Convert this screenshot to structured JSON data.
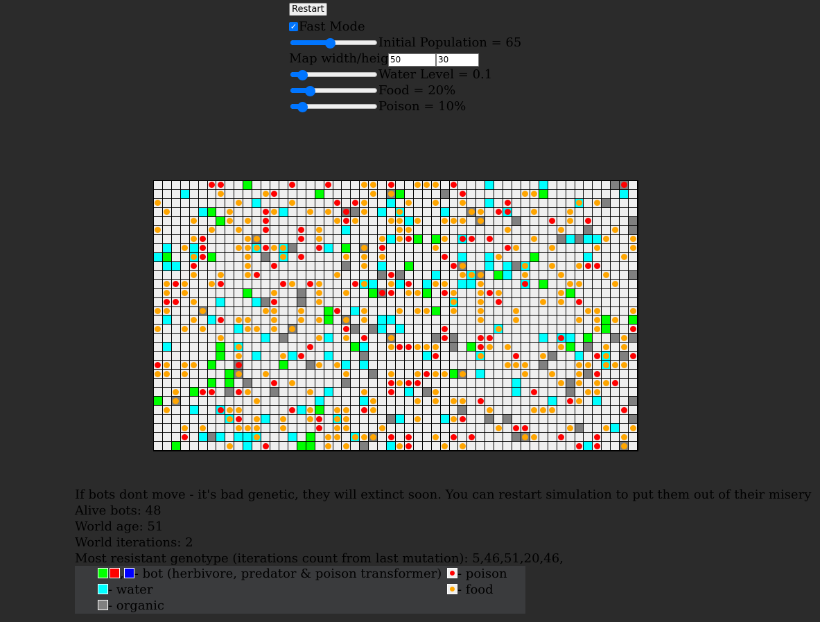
{
  "controls": {
    "restart_label": "Restart",
    "fast_mode_label": "Fast Mode",
    "fast_mode_checked": true,
    "initial_population_label": "Initial Population = 65",
    "initial_population_level": 0.45,
    "map_size_label": "Map width/height",
    "map_width": "50",
    "map_height": "30",
    "water_level_label": "Water Level = 0.1",
    "water_level_level": 0.1,
    "food_label": "Food = 20%",
    "food_level": 0.2,
    "poison_label": "Poison = 10%",
    "poison_level": 0.1
  },
  "colors": {
    "background": "#2b2b2b",
    "cell_empty": "#efefef",
    "water": "#00ffff",
    "organic": "#808080",
    "herbivore": "#00ff00",
    "predator": "#ff0000",
    "poison_transformer": "#0000ff",
    "food": "#ffa500",
    "poison": "#ff0000",
    "accent": "#0075ff"
  },
  "info": {
    "hint": "If bots dont move - it's bad genetic, they will extinct soon. You can restart simulation to put them out of their misery",
    "alive_bots": "Alive bots: 48",
    "world_age": "World age: 51",
    "world_iterations": "World iterations: 2",
    "resistant_genotype": "Most resistant genotype (iterations count from last mutation): 5,46,51,20,46,"
  },
  "legend": {
    "bot_label": "- bot (herbivore, predator & poison transformer)",
    "bot_sep": ",",
    "water_label": "- water",
    "organic_label": "- organic",
    "poison_label": "- poison",
    "food_label": "- food"
  }
}
